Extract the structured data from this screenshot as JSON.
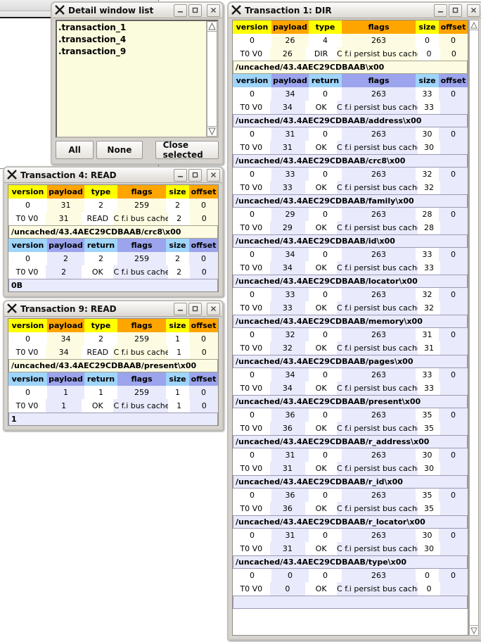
{
  "windows": {
    "detail_list": {
      "title": "Detail window list",
      "items": [
        ".transaction_1",
        ".transaction_4",
        ".transaction_9"
      ],
      "buttons": {
        "all": "All",
        "none": "None",
        "close_selected": "Close selected"
      },
      "titlebar_buttons": {
        "minimize": "minimize-icon",
        "maximize": "maximize-icon",
        "close": "close-icon"
      }
    },
    "tx4": {
      "title": "Transaction 4: READ",
      "request": {
        "headers": [
          "version",
          "payload",
          "type",
          "flags",
          "size",
          "offset"
        ],
        "rows": [
          [
            "0",
            "31",
            "2",
            "259",
            "2",
            "0"
          ],
          [
            "T0 V0",
            "31",
            "READ",
            "C f.i bus cache",
            "2",
            "0"
          ]
        ]
      },
      "request_path": "/uncached/43.4AEC29CDBAAB/crc8\\x00",
      "response": {
        "headers": [
          "version",
          "payload",
          "return",
          "flags",
          "size",
          "offset"
        ],
        "rows": [
          [
            "0",
            "2",
            "2",
            "259",
            "2",
            "0"
          ],
          [
            "T0 V0",
            "2",
            "OK",
            "C f.i bus cache",
            "2",
            "0"
          ]
        ]
      },
      "response_data": "0B"
    },
    "tx9": {
      "title": "Transaction 9: READ",
      "request": {
        "headers": [
          "version",
          "payload",
          "type",
          "flags",
          "size",
          "offset"
        ],
        "rows": [
          [
            "0",
            "34",
            "2",
            "259",
            "1",
            "0"
          ],
          [
            "T0 V0",
            "34",
            "READ",
            "C f.i bus cache",
            "1",
            "0"
          ]
        ]
      },
      "request_path": "/uncached/43.4AEC29CDBAAB/present\\x00",
      "response": {
        "headers": [
          "version",
          "payload",
          "return",
          "flags",
          "size",
          "offset"
        ],
        "rows": [
          [
            "0",
            "1",
            "1",
            "259",
            "1",
            "0"
          ],
          [
            "T0 V0",
            "1",
            "OK",
            "C f.i bus cache",
            "1",
            "0"
          ]
        ]
      },
      "response_data": "1"
    },
    "tx1": {
      "title": "Transaction 1: DIR",
      "request": {
        "headers": [
          "version",
          "payload",
          "type",
          "flags",
          "size",
          "offset"
        ],
        "rows": [
          [
            "0",
            "26",
            "4",
            "263",
            "0",
            "0"
          ],
          [
            "T0 V0",
            "26",
            "DIR",
            "C f.i persist bus cache",
            "0",
            "0"
          ]
        ]
      },
      "request_path": "/uncached/43.4AEC29CDBAAB\\x00",
      "response_headers": [
        "version",
        "payload",
        "return",
        "flags",
        "size",
        "offset"
      ],
      "responses": [
        {
          "rows": [
            [
              "0",
              "34",
              "0",
              "263",
              "33",
              "0"
            ],
            [
              "T0 V0",
              "34",
              "OK",
              "C f.i persist bus cache",
              "33",
              ""
            ]
          ],
          "path": "/uncached/43.4AEC29CDBAAB/address\\x00"
        },
        {
          "rows": [
            [
              "0",
              "31",
              "0",
              "263",
              "30",
              "0"
            ],
            [
              "T0 V0",
              "31",
              "OK",
              "C f.i persist bus cache",
              "30",
              ""
            ]
          ],
          "path": "/uncached/43.4AEC29CDBAAB/crc8\\x00"
        },
        {
          "rows": [
            [
              "0",
              "33",
              "0",
              "263",
              "32",
              "0"
            ],
            [
              "T0 V0",
              "33",
              "OK",
              "C f.i persist bus cache",
              "32",
              ""
            ]
          ],
          "path": "/uncached/43.4AEC29CDBAAB/family\\x00"
        },
        {
          "rows": [
            [
              "0",
              "29",
              "0",
              "263",
              "28",
              "0"
            ],
            [
              "T0 V0",
              "29",
              "OK",
              "C f.i persist bus cache",
              "28",
              ""
            ]
          ],
          "path": "/uncached/43.4AEC29CDBAAB/id\\x00"
        },
        {
          "rows": [
            [
              "0",
              "34",
              "0",
              "263",
              "33",
              "0"
            ],
            [
              "T0 V0",
              "34",
              "OK",
              "C f.i persist bus cache",
              "33",
              ""
            ]
          ],
          "path": "/uncached/43.4AEC29CDBAAB/locator\\x00"
        },
        {
          "rows": [
            [
              "0",
              "33",
              "0",
              "263",
              "32",
              "0"
            ],
            [
              "T0 V0",
              "33",
              "OK",
              "C f.i persist bus cache",
              "32",
              ""
            ]
          ],
          "path": "/uncached/43.4AEC29CDBAAB/memory\\x00"
        },
        {
          "rows": [
            [
              "0",
              "32",
              "0",
              "263",
              "31",
              "0"
            ],
            [
              "T0 V0",
              "32",
              "OK",
              "C f.i persist bus cache",
              "31",
              ""
            ]
          ],
          "path": "/uncached/43.4AEC29CDBAAB/pages\\x00"
        },
        {
          "rows": [
            [
              "0",
              "34",
              "0",
              "263",
              "33",
              "0"
            ],
            [
              "T0 V0",
              "34",
              "OK",
              "C f.i persist bus cache",
              "33",
              ""
            ]
          ],
          "path": "/uncached/43.4AEC29CDBAAB/present\\x00"
        },
        {
          "rows": [
            [
              "0",
              "36",
              "0",
              "263",
              "35",
              "0"
            ],
            [
              "T0 V0",
              "36",
              "OK",
              "C f.i persist bus cache",
              "35",
              ""
            ]
          ],
          "path": "/uncached/43.4AEC29CDBAAB/r_address\\x00"
        },
        {
          "rows": [
            [
              "0",
              "31",
              "0",
              "263",
              "30",
              "0"
            ],
            [
              "T0 V0",
              "31",
              "OK",
              "C f.i persist bus cache",
              "30",
              ""
            ]
          ],
          "path": "/uncached/43.4AEC29CDBAAB/r_id\\x00"
        },
        {
          "rows": [
            [
              "0",
              "36",
              "0",
              "263",
              "35",
              "0"
            ],
            [
              "T0 V0",
              "36",
              "OK",
              "C f.i persist bus cache",
              "35",
              ""
            ]
          ],
          "path": "/uncached/43.4AEC29CDBAAB/r_locator\\x00"
        },
        {
          "rows": [
            [
              "0",
              "31",
              "0",
              "263",
              "30",
              "0"
            ],
            [
              "T0 V0",
              "31",
              "OK",
              "C f.i persist bus cache",
              "30",
              ""
            ]
          ],
          "path": "/uncached/43.4AEC29CDBAAB/type\\x00"
        },
        {
          "rows": [
            [
              "0",
              "0",
              "0",
              "263",
              "0",
              "0"
            ],
            [
              "T0 V0",
              "0",
              "OK",
              "C f.i persist bus cache",
              "0",
              ""
            ]
          ],
          "path": ""
        }
      ]
    }
  },
  "colors": {
    "req_header_a": "#ffff00",
    "req_header_b": "#ffa500",
    "req_cell_b": "#fdfce2",
    "rsp_header_a": "#9fd4fb",
    "rsp_header_b": "#9ba4ec",
    "rsp_cell_b": "#e9eafb",
    "window_face": "#d6d3ce",
    "list_face": "#fbfbdd"
  }
}
